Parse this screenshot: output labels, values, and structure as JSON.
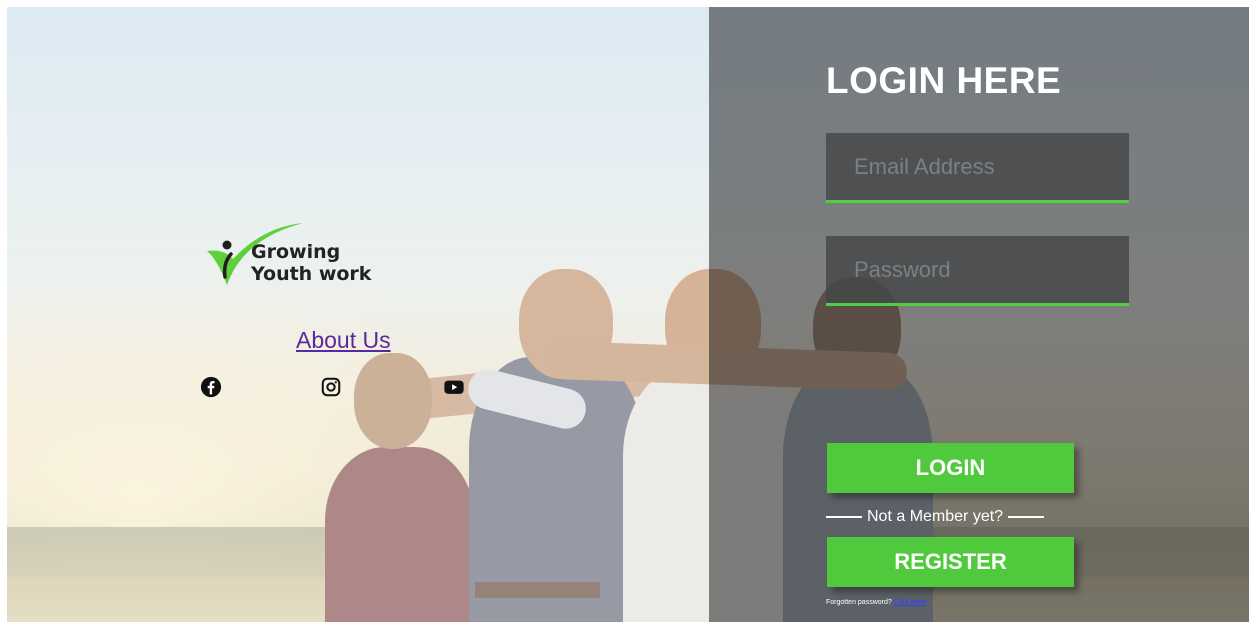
{
  "brand": {
    "line1": "Growing",
    "line2": "Youth work",
    "logo_icon": "checkmark-person-logo",
    "accent_color": "#50c93d"
  },
  "nav": {
    "about_label": "About Us"
  },
  "social": {
    "facebook_icon": "facebook-icon",
    "instagram_icon": "instagram-icon",
    "youtube_icon": "youtube-icon"
  },
  "login": {
    "title": "LOGIN HERE",
    "email_placeholder": "Email Address",
    "password_placeholder": "Password",
    "login_button": "LOGIN",
    "divider_text": "Not a Member yet?",
    "register_button": "REGISTER",
    "forgot_prefix": "Forgotten password?",
    "forgot_link": "Click here!"
  }
}
